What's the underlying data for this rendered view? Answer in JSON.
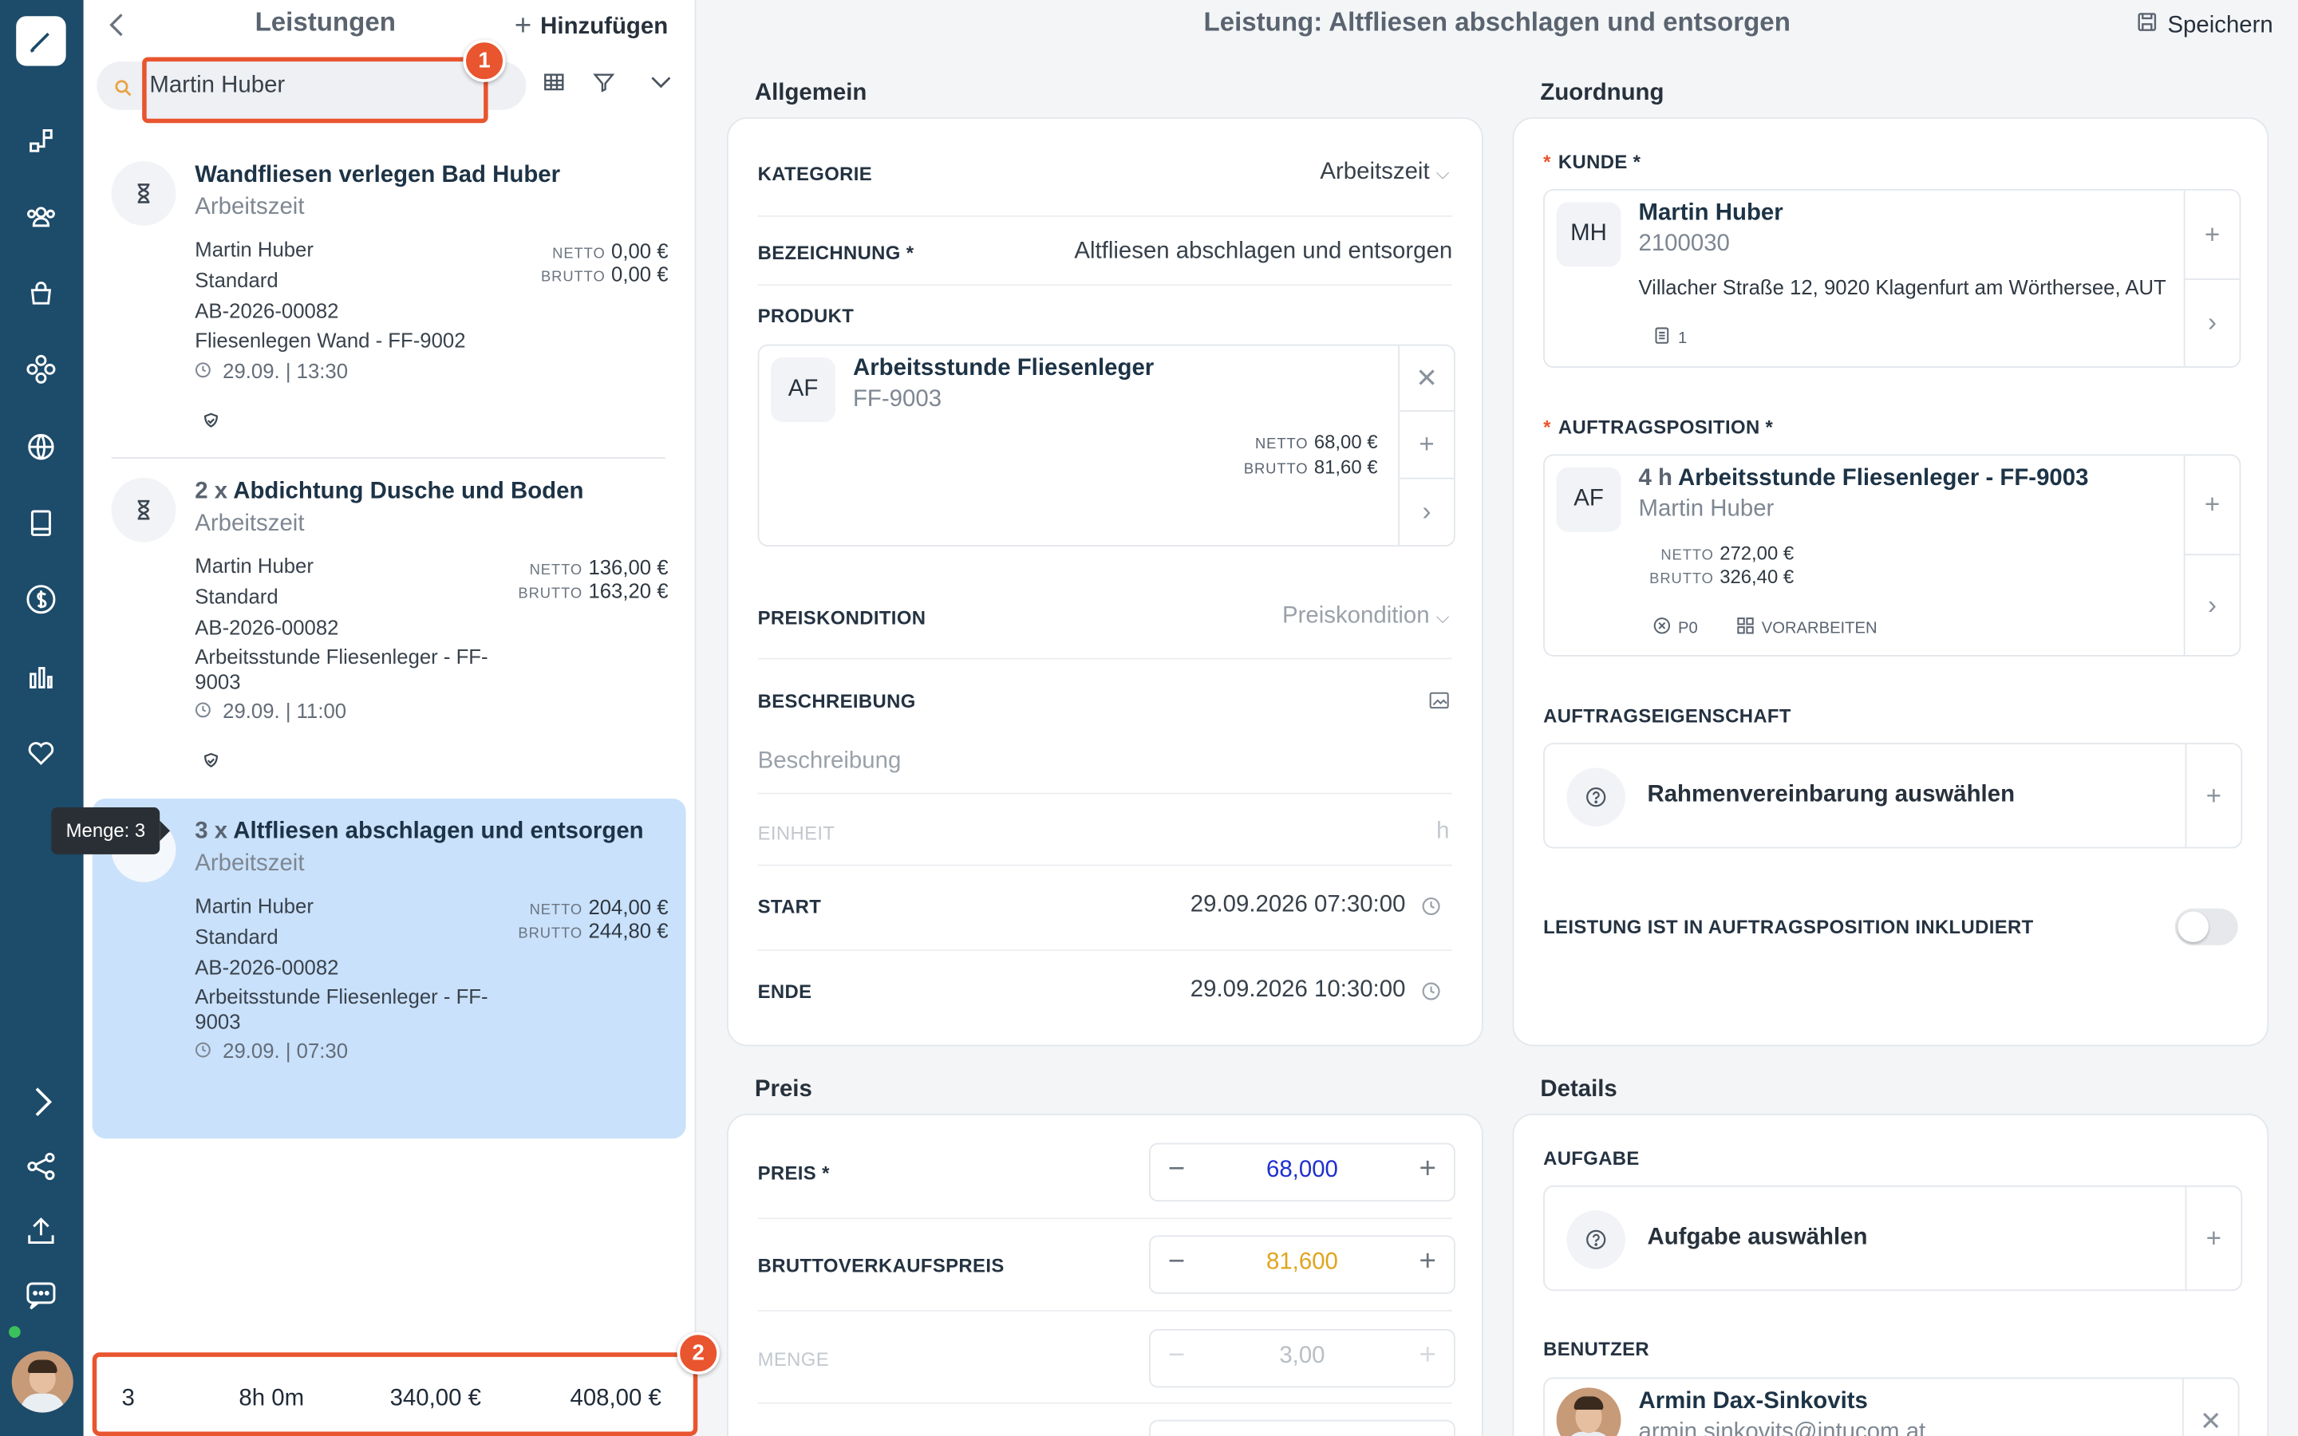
{
  "sidebar": {
    "icons": [
      "brush-logo-icon",
      "process-icon",
      "users-icon",
      "bag-icon",
      "modules-icon",
      "globe-icon",
      "book-icon",
      "dollar-icon",
      "chart-icon",
      "heart-icon",
      "chevron-right-icon",
      "share-icon",
      "upload-icon",
      "chat-icon"
    ]
  },
  "list": {
    "title": "Leistungen",
    "add_label": "Hinzufügen",
    "search_value": "Martin Huber",
    "annotation_search": "1",
    "annotation_footer": "2",
    "items": [
      {
        "qty": "",
        "title": "Wandfliesen verlegen Bad Huber",
        "subtitle": "Arbeitszeit",
        "customer": "Martin Huber",
        "type": "Standard",
        "order": "AB-2026-00082",
        "product": "Fliesenlegen Wand - FF-9002",
        "time": "29.09. | 13:30",
        "netto_label": "NETTO",
        "netto": "0,00 €",
        "brutto_label": "BRUTTO",
        "brutto": "0,00 €"
      },
      {
        "qty": "2 x",
        "title": "Abdichtung Dusche und Boden",
        "subtitle": "Arbeitszeit",
        "customer": "Martin Huber",
        "type": "Standard",
        "order": "AB-2026-00082",
        "product": "Arbeitsstunde Fliesenleger - FF-9003",
        "time": "29.09. | 11:00",
        "netto_label": "NETTO",
        "netto": "136,00 €",
        "brutto_label": "BRUTTO",
        "brutto": "163,20 €"
      },
      {
        "qty": "3 x",
        "title": "Altfliesen abschlagen und entsorgen",
        "subtitle": "Arbeitszeit",
        "customer": "Martin Huber",
        "type": "Standard",
        "order": "AB-2026-00082",
        "product": "Arbeitsstunde Fliesenleger - FF-9003",
        "time": "29.09. | 07:30",
        "netto_label": "NETTO",
        "netto": "204,00 €",
        "brutto_label": "BRUTTO",
        "brutto": "244,80 €"
      }
    ],
    "tooltip": "Menge: 3",
    "footer": {
      "count": "3",
      "duration": "8h 0m",
      "netto": "340,00 €",
      "brutto": "408,00 €"
    }
  },
  "page": {
    "title": "Leistung: Altfliesen abschlagen und entsorgen",
    "save_label": "Speichern"
  },
  "allgemein": {
    "section": "Allgemein",
    "kategorie_label": "KATEGORIE",
    "kategorie_value": "Arbeitszeit",
    "bezeichnung_label": "BEZEICHNUNG *",
    "bezeichnung_value": "Altfliesen abschlagen und entsorgen",
    "produkt_label": "PRODUKT",
    "produkt": {
      "initials": "AF",
      "name": "Arbeitsstunde Fliesenleger",
      "code": "FF-9003",
      "netto_label": "NETTO",
      "netto": "68,00 €",
      "brutto_label": "BRUTTO",
      "brutto": "81,60 €"
    },
    "preiskondition_label": "PREISKONDITION",
    "preiskondition_placeholder": "Preiskondition",
    "beschreibung_label": "BESCHREIBUNG",
    "beschreibung_placeholder": "Beschreibung",
    "einheit_label": "EINHEIT",
    "einheit_value": "h",
    "start_label": "START",
    "start_value": "29.09.2026 07:30:00",
    "ende_label": "ENDE",
    "ende_value": "29.09.2026 10:30:00"
  },
  "preis": {
    "section": "Preis",
    "preis_label": "PREIS *",
    "preis_value": "68,000",
    "brutto_label": "BRUTTOVERKAUFSPREIS",
    "brutto_value": "81,600",
    "menge_label": "MENGE",
    "menge_value": "3,00",
    "colors": {
      "preis": "#1e2fd0",
      "brutto": "#e0a51c"
    }
  },
  "zuordnung": {
    "section": "Zuordnung",
    "kunde_label": "KUNDE *",
    "kunde": {
      "initials": "MH",
      "name": "Martin Huber",
      "number": "2100030",
      "address": "Villacher Straße 12, 9020 Klagenfurt am Wörthersee, AUT",
      "docs": "1"
    },
    "auftragsposition_label": "AUFTRAGSPOSITION *",
    "auftragsposition": {
      "initials": "AF",
      "qty": "4 h",
      "name": "Arbeitsstunde Fliesenleger - FF-9003",
      "customer": "Martin Huber",
      "netto_label": "NETTO",
      "netto": "272,00 €",
      "brutto_label": "BRUTTO",
      "brutto": "326,40 €",
      "pos": "P0",
      "status": "VORARBEITEN"
    },
    "eigenschaft_label": "AUFTRAGSEIGENSCHAFT",
    "eigenschaft_placeholder": "Rahmenvereinbarung auswählen",
    "inkludiert_label": "LEISTUNG IST IN AUFTRAGSPOSITION INKLUDIERT"
  },
  "details": {
    "section": "Details",
    "aufgabe_label": "AUFGABE",
    "aufgabe_placeholder": "Aufgabe auswählen",
    "benutzer_label": "BENUTZER",
    "benutzer_name": "Armin Dax-Sinkovits",
    "benutzer_email": "armin.sinkovits@intucom.at"
  }
}
